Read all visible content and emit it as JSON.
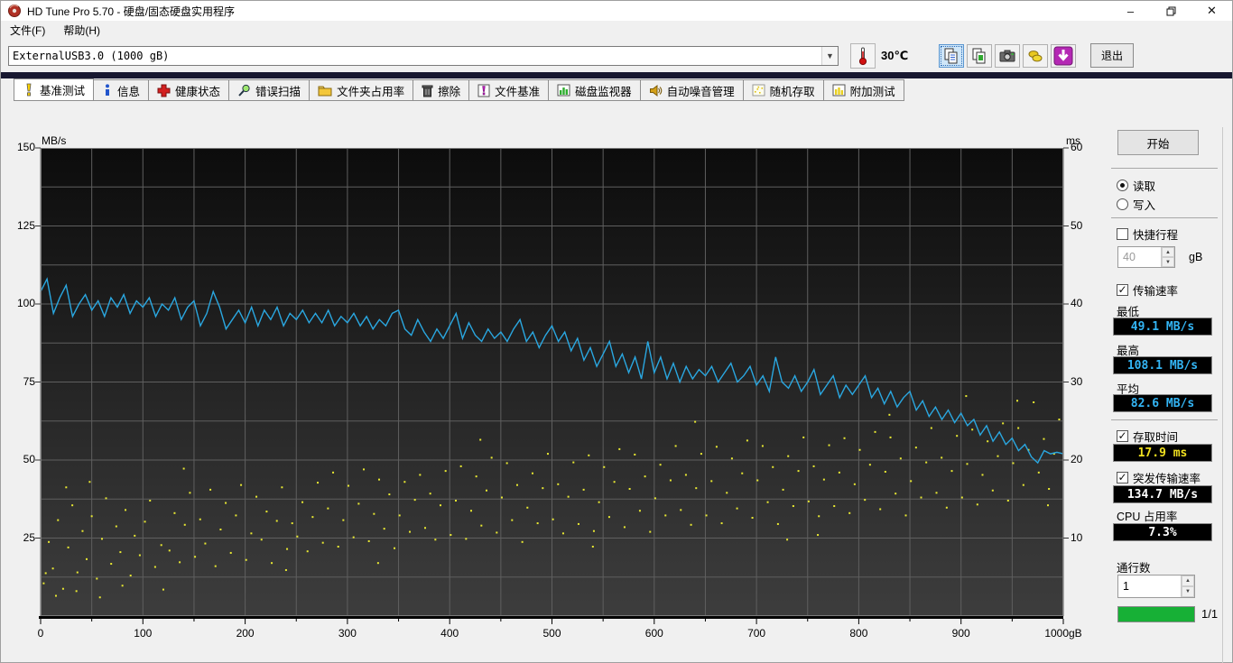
{
  "window": {
    "title": "HD Tune Pro 5.70 - 硬盘/固态硬盘实用程序",
    "controls": {
      "minimize": "–",
      "restore": "restore",
      "close": "✕"
    }
  },
  "menu": {
    "items": [
      {
        "label": "文件(F)"
      },
      {
        "label": "帮助(H)"
      }
    ]
  },
  "toolbar": {
    "drive_selector": "ExternalUSB3.0 (1000 gB)",
    "temperature": "30℃",
    "icons": [
      {
        "name": "copy-text-icon",
        "selected": true
      },
      {
        "name": "copy-image-icon",
        "selected": false
      },
      {
        "name": "camera-icon",
        "selected": false
      },
      {
        "name": "tools-icon",
        "selected": false
      },
      {
        "name": "download-icon",
        "selected": false
      }
    ],
    "exit_label": "退出"
  },
  "tabs": [
    {
      "label": "基准测试",
      "icon": "benchmark-icon",
      "active": true
    },
    {
      "label": "信息",
      "icon": "info-icon",
      "active": false
    },
    {
      "label": "健康状态",
      "icon": "health-icon",
      "active": false
    },
    {
      "label": "错误扫描",
      "icon": "error-scan-icon",
      "active": false
    },
    {
      "label": "文件夹占用率",
      "icon": "folder-usage-icon",
      "active": false
    },
    {
      "label": "擦除",
      "icon": "erase-icon",
      "active": false
    },
    {
      "label": "文件基准",
      "icon": "file-benchmark-icon",
      "active": false
    },
    {
      "label": "磁盘监视器",
      "icon": "disk-monitor-icon",
      "active": false
    },
    {
      "label": "自动噪音管理",
      "icon": "aam-icon",
      "active": false
    },
    {
      "label": "随机存取",
      "icon": "random-access-icon",
      "active": false
    },
    {
      "label": "附加测试",
      "icon": "extra-tests-icon",
      "active": false
    }
  ],
  "side_panel": {
    "start_label": "开始",
    "mode": {
      "read_label": "读取",
      "write_label": "写入",
      "selected": "read"
    },
    "short_stroke": {
      "label": "快捷行程",
      "checked": false,
      "value": "40",
      "unit": "gB"
    },
    "transfer_rate": {
      "label": "传输速率",
      "checked": true,
      "min_label": "最低",
      "min_value": "49.1 MB/s",
      "max_label": "最高",
      "max_value": "108.1 MB/s",
      "avg_label": "平均",
      "avg_value": "82.6 MB/s"
    },
    "access_time": {
      "label": "存取时间",
      "checked": true,
      "value": "17.9 ms"
    },
    "burst_rate": {
      "label": "突发传输速率",
      "checked": true,
      "value": "134.7 MB/s"
    },
    "cpu_usage": {
      "label": "CPU 占用率",
      "value": "7.3%"
    },
    "pass_count": {
      "label": "通行数",
      "value": "1"
    },
    "progress": {
      "label": "1/1",
      "percent": 100,
      "color": "#17b036"
    }
  },
  "chart_data": {
    "type": "line+scatter",
    "title": "HD Tune read benchmark: transfer rate line (MB/s) with access time scatter (ms) vs disk position (gB)",
    "left_axis": {
      "label": "MB/s",
      "min": 0,
      "max": 150,
      "ticks": [
        150,
        125,
        100,
        75,
        50,
        25
      ]
    },
    "right_axis": {
      "label": "ms",
      "min": 0,
      "max": 60,
      "ticks": [
        60,
        50,
        40,
        30,
        20,
        10
      ]
    },
    "x_axis": {
      "min": 0,
      "max": 1000,
      "ticks": [
        0,
        100,
        200,
        300,
        400,
        500,
        600,
        700,
        800,
        900
      ],
      "last_tick_label": "1000gB",
      "minor_step": 50
    },
    "grid": {
      "color": "#5f5f5f",
      "x_step": 50,
      "y_step_mbps": 12.5
    },
    "plot_background": {
      "top": "#0c0c0c",
      "bottom": "#3d3d3d"
    },
    "series": [
      {
        "name": "transfer-rate",
        "type": "line",
        "color": "#2aa7e0",
        "unit": "MB/s",
        "x_start": 0,
        "x_step": 6.25,
        "values": [
          104,
          108,
          97,
          102,
          106,
          96,
          100,
          103,
          98,
          101,
          96,
          102,
          99,
          103,
          97,
          101,
          99,
          102,
          96,
          100,
          98,
          102,
          95,
          99,
          101,
          93,
          97,
          104,
          99,
          92,
          95,
          98,
          94,
          99,
          93,
          98,
          95,
          99,
          93,
          97,
          95,
          98,
          94,
          97,
          94,
          98,
          93,
          96,
          94,
          97,
          93,
          96,
          92,
          95,
          93,
          97,
          98,
          92,
          90,
          95,
          91,
          88,
          92,
          89,
          93,
          97,
          89,
          94,
          90,
          88,
          92,
          89,
          91,
          88,
          92,
          95,
          88,
          91,
          86,
          90,
          93,
          88,
          91,
          85,
          89,
          82,
          86,
          80,
          84,
          88,
          80,
          84,
          78,
          83,
          76,
          88,
          78,
          83,
          76,
          81,
          75,
          80,
          76,
          79,
          77,
          80,
          75,
          78,
          81,
          75,
          77,
          80,
          74,
          77,
          72,
          83,
          75,
          73,
          77,
          72,
          75,
          79,
          71,
          74,
          77,
          70,
          74,
          71,
          74,
          77,
          70,
          73,
          68,
          72,
          67,
          70,
          72,
          66,
          69,
          64,
          67,
          63,
          66,
          62,
          65,
          61,
          63,
          58,
          61,
          56,
          59,
          55,
          57,
          53,
          55,
          51,
          49.1,
          53,
          52,
          52.5,
          52
        ]
      },
      {
        "name": "access-time",
        "type": "scatter",
        "color": "#e8e832",
        "unit": "ms",
        "points": [
          [
            3,
            4.2
          ],
          [
            8,
            9.5
          ],
          [
            12,
            6.1
          ],
          [
            17,
            12.3
          ],
          [
            22,
            3.5
          ],
          [
            27,
            8.8
          ],
          [
            31,
            14.2
          ],
          [
            36,
            5.6
          ],
          [
            41,
            10.9
          ],
          [
            45,
            7.3
          ],
          [
            50,
            12.8
          ],
          [
            55,
            4.8
          ],
          [
            60,
            9.9
          ],
          [
            64,
            15.1
          ],
          [
            69,
            6.7
          ],
          [
            74,
            11.5
          ],
          [
            78,
            8.2
          ],
          [
            83,
            13.6
          ],
          [
            88,
            5.2
          ],
          [
            92,
            10.3
          ],
          [
            97,
            7.8
          ],
          [
            102,
            12.1
          ],
          [
            107,
            14.8
          ],
          [
            112,
            6.3
          ],
          [
            118,
            9.1
          ],
          [
            126,
            8.4
          ],
          [
            131,
            13.2
          ],
          [
            136,
            6.9
          ],
          [
            141,
            11.7
          ],
          [
            146,
            15.8
          ],
          [
            151,
            7.6
          ],
          [
            156,
            12.4
          ],
          [
            161,
            9.3
          ],
          [
            166,
            16.2
          ],
          [
            171,
            6.4
          ],
          [
            176,
            11.1
          ],
          [
            181,
            14.5
          ],
          [
            186,
            8.1
          ],
          [
            191,
            12.9
          ],
          [
            196,
            16.8
          ],
          [
            201,
            7.2
          ],
          [
            206,
            10.6
          ],
          [
            211,
            15.3
          ],
          [
            216,
            9.8
          ],
          [
            221,
            13.4
          ],
          [
            226,
            6.8
          ],
          [
            231,
            12.2
          ],
          [
            236,
            16.5
          ],
          [
            241,
            8.6
          ],
          [
            246,
            11.9
          ],
          [
            251,
            10.2
          ],
          [
            256,
            14.6
          ],
          [
            261,
            8.3
          ],
          [
            266,
            12.7
          ],
          [
            271,
            17.1
          ],
          [
            276,
            9.4
          ],
          [
            281,
            13.8
          ],
          [
            286,
            18.4
          ],
          [
            291,
            8.9
          ],
          [
            296,
            12.3
          ],
          [
            301,
            16.7
          ],
          [
            306,
            10.1
          ],
          [
            311,
            14.4
          ],
          [
            316,
            18.8
          ],
          [
            321,
            9.6
          ],
          [
            326,
            13.1
          ],
          [
            331,
            17.5
          ],
          [
            336,
            11.2
          ],
          [
            341,
            15.6
          ],
          [
            346,
            8.7
          ],
          [
            351,
            12.9
          ],
          [
            356,
            17.2
          ],
          [
            361,
            10.8
          ],
          [
            366,
            14.9
          ],
          [
            371,
            18.1
          ],
          [
            376,
            11.3
          ],
          [
            381,
            15.7
          ],
          [
            386,
            9.8
          ],
          [
            391,
            14.2
          ],
          [
            396,
            18.6
          ],
          [
            401,
            10.4
          ],
          [
            406,
            14.8
          ],
          [
            411,
            19.2
          ],
          [
            416,
            9.9
          ],
          [
            421,
            13.5
          ],
          [
            426,
            17.9
          ],
          [
            431,
            11.6
          ],
          [
            436,
            16.1
          ],
          [
            441,
            20.3
          ],
          [
            446,
            10.7
          ],
          [
            451,
            15.2
          ],
          [
            456,
            19.6
          ],
          [
            461,
            12.3
          ],
          [
            466,
            16.8
          ],
          [
            471,
            9.5
          ],
          [
            476,
            13.9
          ],
          [
            481,
            18.3
          ],
          [
            486,
            11.9
          ],
          [
            491,
            16.4
          ],
          [
            496,
            20.8
          ],
          [
            501,
            12.4
          ],
          [
            506,
            16.9
          ],
          [
            511,
            10.6
          ],
          [
            516,
            15.3
          ],
          [
            521,
            19.7
          ],
          [
            526,
            11.8
          ],
          [
            531,
            16.2
          ],
          [
            536,
            20.6
          ],
          [
            541,
            10.9
          ],
          [
            546,
            14.6
          ],
          [
            551,
            19.1
          ],
          [
            556,
            12.7
          ],
          [
            561,
            17.2
          ],
          [
            566,
            21.4
          ],
          [
            571,
            11.4
          ],
          [
            576,
            16.3
          ],
          [
            581,
            20.7
          ],
          [
            586,
            13.5
          ],
          [
            591,
            17.9
          ],
          [
            596,
            10.8
          ],
          [
            601,
            15.1
          ],
          [
            606,
            19.4
          ],
          [
            611,
            12.9
          ],
          [
            616,
            17.4
          ],
          [
            621,
            21.8
          ],
          [
            626,
            13.6
          ],
          [
            631,
            18.1
          ],
          [
            636,
            11.7
          ],
          [
            641,
            16.4
          ],
          [
            646,
            20.8
          ],
          [
            651,
            12.9
          ],
          [
            656,
            17.3
          ],
          [
            661,
            21.7
          ],
          [
            666,
            11.9
          ],
          [
            671,
            15.8
          ],
          [
            676,
            20.2
          ],
          [
            681,
            13.8
          ],
          [
            686,
            18.3
          ],
          [
            691,
            22.5
          ],
          [
            696,
            12.6
          ],
          [
            701,
            17.4
          ],
          [
            706,
            21.8
          ],
          [
            711,
            14.6
          ],
          [
            716,
            19.1
          ],
          [
            721,
            11.8
          ],
          [
            726,
            16.2
          ],
          [
            731,
            20.5
          ],
          [
            736,
            14.1
          ],
          [
            741,
            18.6
          ],
          [
            746,
            22.9
          ],
          [
            751,
            14.7
          ],
          [
            756,
            19.2
          ],
          [
            761,
            12.8
          ],
          [
            766,
            17.5
          ],
          [
            771,
            21.9
          ],
          [
            776,
            14.1
          ],
          [
            781,
            18.4
          ],
          [
            786,
            22.8
          ],
          [
            791,
            13.2
          ],
          [
            796,
            16.9
          ],
          [
            801,
            21.3
          ],
          [
            806,
            14.9
          ],
          [
            811,
            19.4
          ],
          [
            816,
            23.6
          ],
          [
            821,
            13.7
          ],
          [
            826,
            18.5
          ],
          [
            831,
            22.9
          ],
          [
            836,
            15.7
          ],
          [
            841,
            20.2
          ],
          [
            846,
            12.9
          ],
          [
            851,
            17.3
          ],
          [
            856,
            21.6
          ],
          [
            861,
            15.2
          ],
          [
            866,
            19.7
          ],
          [
            871,
            24.1
          ],
          [
            876,
            15.8
          ],
          [
            881,
            20.3
          ],
          [
            886,
            13.9
          ],
          [
            891,
            18.6
          ],
          [
            896,
            23.1
          ],
          [
            901,
            15.2
          ],
          [
            906,
            19.5
          ],
          [
            911,
            23.9
          ],
          [
            916,
            14.3
          ],
          [
            921,
            18.1
          ],
          [
            926,
            22.4
          ],
          [
            931,
            16.1
          ],
          [
            936,
            20.5
          ],
          [
            941,
            24.7
          ],
          [
            946,
            14.8
          ],
          [
            951,
            19.6
          ],
          [
            956,
            24.1
          ],
          [
            961,
            16.8
          ],
          [
            966,
            21.3
          ],
          [
            971,
            27.4
          ],
          [
            976,
            18.4
          ],
          [
            981,
            22.7
          ],
          [
            986,
            16.3
          ],
          [
            991,
            20.8
          ],
          [
            996,
            25.2
          ],
          [
            15,
            2.6
          ],
          [
            35,
            3.2
          ],
          [
            58,
            2.4
          ],
          [
            80,
            3.9
          ],
          [
            5,
            5.5
          ],
          [
            25,
            16.5
          ],
          [
            48,
            17.2
          ],
          [
            120,
            3.4
          ],
          [
            140,
            18.9
          ],
          [
            240,
            5.9
          ],
          [
            330,
            6.8
          ],
          [
            430,
            22.6
          ],
          [
            540,
            8.9
          ],
          [
            640,
            24.9
          ],
          [
            730,
            9.8
          ],
          [
            830,
            25.8
          ],
          [
            905,
            28.2
          ],
          [
            955,
            27.6
          ],
          [
            760,
            10.4
          ],
          [
            985,
            14.2
          ]
        ]
      }
    ]
  }
}
